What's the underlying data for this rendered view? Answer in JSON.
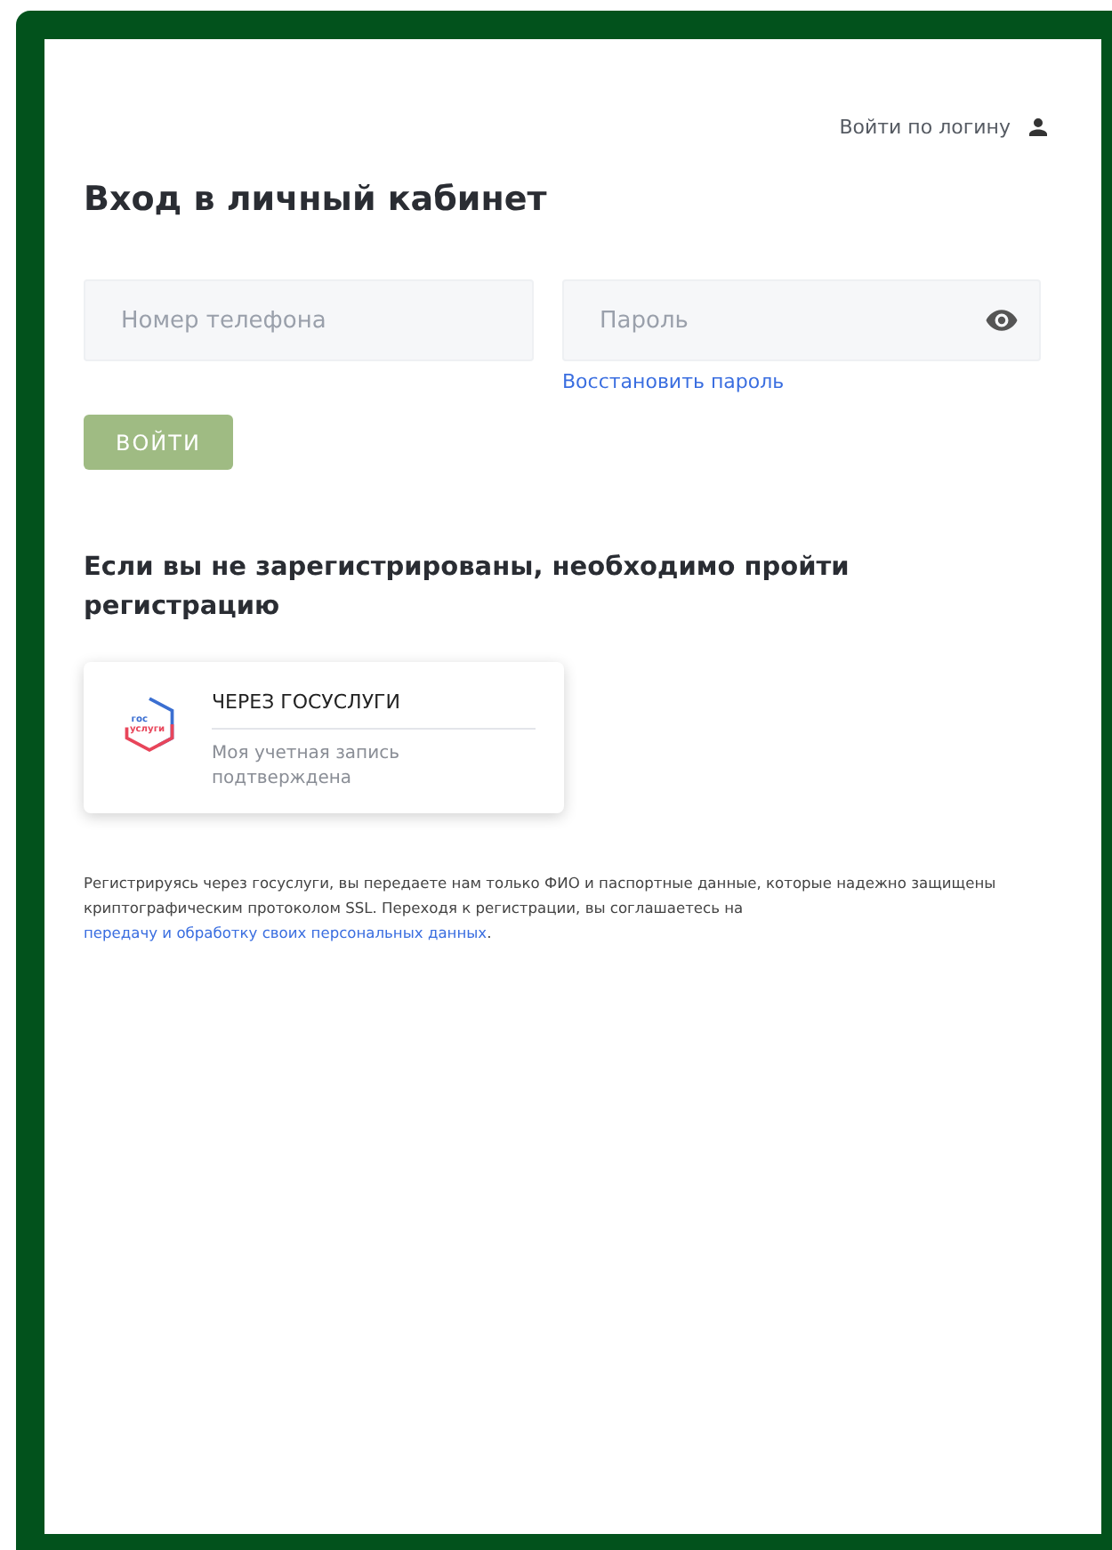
{
  "login_link": "Войти по логину",
  "title": "Вход в личный кабинет",
  "phone_field": {
    "placeholder": "Номер телефона"
  },
  "password_field": {
    "placeholder": "Пароль"
  },
  "restore_link": "Восстановить пароль",
  "submit_button": {
    "label": "ВОЙТИ",
    "disabled": true
  },
  "registration_heading": "Если вы не зарегистрированы, необходимо пройти регистрацию",
  "gosuslugi_card": {
    "logo_text": [
      "гос",
      "услуги"
    ],
    "title": "ЧЕРЕЗ ГОСУСЛУГИ",
    "subtitle": "Моя учетная запись подтверждена"
  },
  "notice": {
    "text": "Регистрируясь через госуслуги, вы передаете нам только ФИО и паспортные данные, которые надежно защищены криптографическим протоколом SSL. Переходя к регистрации, вы соглашаетесь на ",
    "link": "передачу и обработку своих персональных данных",
    "end": "."
  }
}
